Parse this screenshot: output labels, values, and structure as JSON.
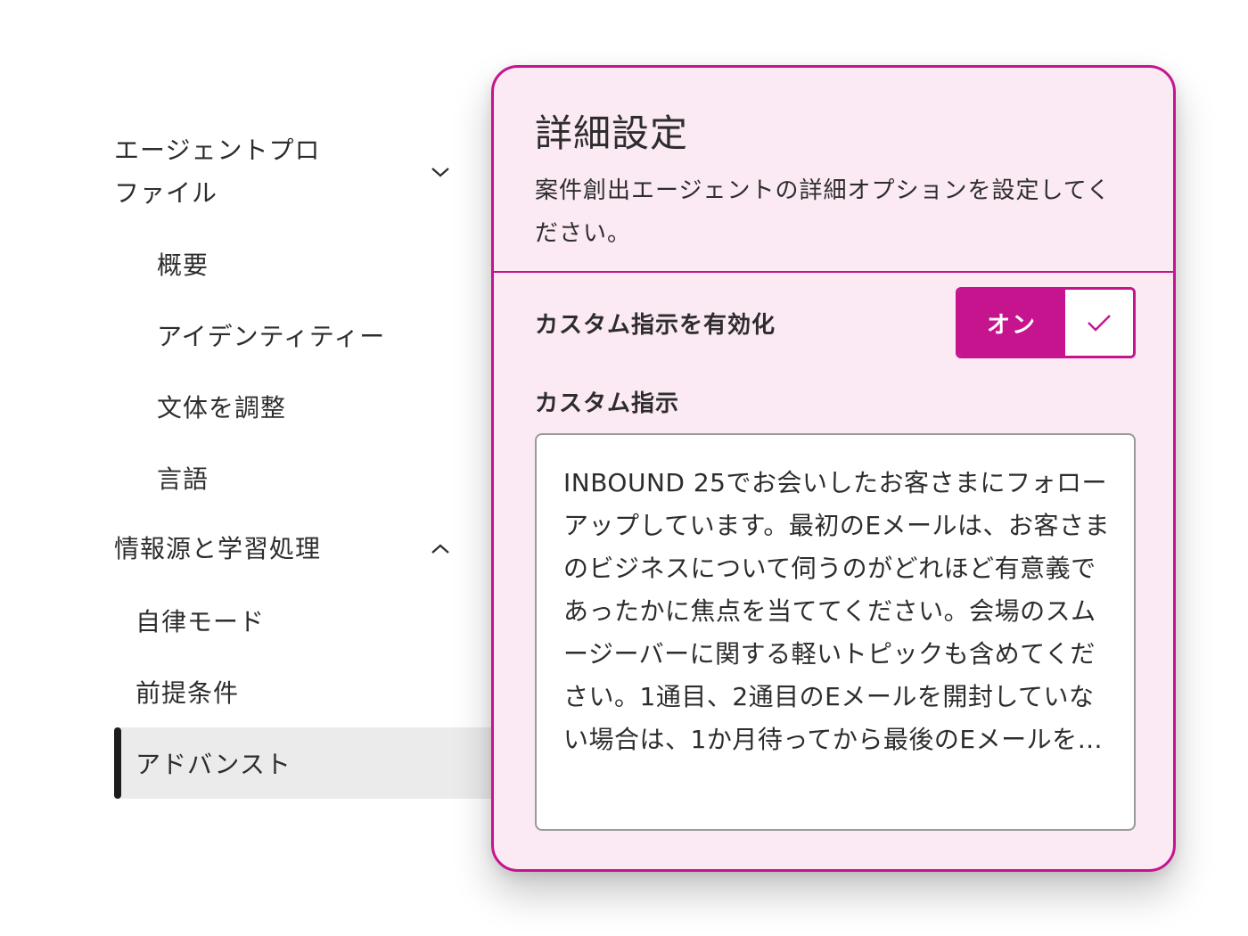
{
  "nav": {
    "profile_group": {
      "label": "エージェントプロファイル",
      "expanded": true,
      "icon": "chevron-down-icon"
    },
    "profile_items": [
      {
        "label": "概要"
      },
      {
        "label": "アイデンティティー"
      },
      {
        "label": "文体を調整"
      },
      {
        "label": "言語"
      }
    ],
    "sources_group": {
      "label": "情報源と学習処理",
      "expanded": true,
      "icon": "chevron-up-icon"
    },
    "sources_items": [
      {
        "label": "自律モード",
        "active": false
      },
      {
        "label": "前提条件",
        "active": false
      },
      {
        "label": "アドバンスト",
        "active": true
      }
    ]
  },
  "panel": {
    "title": "詳細設定",
    "description": "案件創出エージェントの詳細オプションを設定してください。",
    "toggle": {
      "label": "カスタム指示を有効化",
      "state_label": "オン",
      "checked": true,
      "icon": "checkmark-icon"
    },
    "instructions": {
      "label": "カスタム指示",
      "value": "INBOUND 25でお会いしたお客さまにフォローアップしています。最初のEメールは、お客さまのビジネスについて伺うのがどれほど有意義であったかに焦点を当ててください。会場のスムージーバーに関する軽いトピックも含めてください。1通目、2通目のEメールを開封していない場合は、1か月待ってから最後のEメールを…"
    }
  },
  "colors": {
    "accent": "#c6148f",
    "panel_background": "#fbe9f3",
    "active_nav_background": "#ebebeb",
    "active_nav_indicator": "#1d1d1d"
  }
}
